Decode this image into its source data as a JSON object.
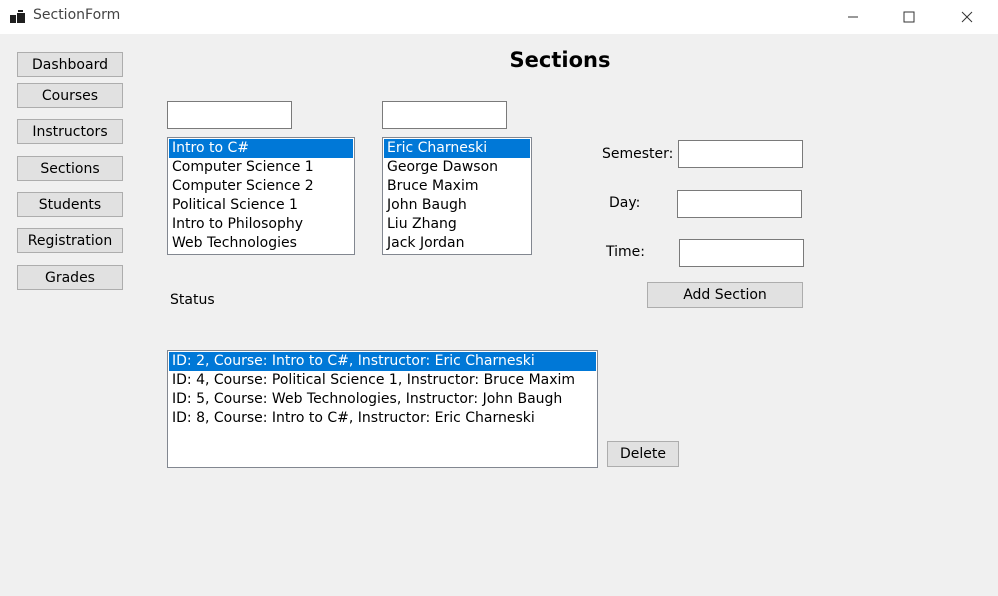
{
  "window": {
    "title": "SectionForm"
  },
  "nav": {
    "dashboard": "Dashboard",
    "courses": "Courses",
    "instructors": "Instructors",
    "sections": "Sections",
    "students": "Students",
    "registration": "Registration",
    "grades": "Grades"
  },
  "page": {
    "title": "Sections"
  },
  "course_filter": {
    "value": ""
  },
  "instructor_filter": {
    "value": ""
  },
  "courses": {
    "selected_index": 0,
    "items": [
      "Intro to C#",
      "Computer Science 1",
      "Computer Science 2",
      "Political Science 1",
      "Intro to Philosophy",
      "Web Technologies"
    ]
  },
  "instructors": {
    "selected_index": 0,
    "items": [
      "Eric Charneski",
      "George Dawson",
      "Bruce Maxim",
      "John Baugh",
      "Liu Zhang",
      "Jack Jordan"
    ]
  },
  "form": {
    "semester_label": "Semester:",
    "semester_value": "",
    "day_label": "Day:",
    "day_value": "",
    "time_label": "Time:",
    "time_value": "",
    "add_button": "Add Section"
  },
  "status": {
    "label": "Status"
  },
  "sections": {
    "selected_index": 0,
    "items": [
      "ID: 2, Course: Intro to C#, Instructor: Eric Charneski",
      "ID: 4, Course: Political Science 1, Instructor: Bruce Maxim",
      "ID: 5, Course: Web Technologies, Instructor: John Baugh",
      "ID: 8, Course: Intro to C#, Instructor: Eric Charneski"
    ]
  },
  "delete_button": "Delete",
  "colors": {
    "selection": "#0078d7",
    "background": "#f0f0f0",
    "button": "#e1e1e1"
  }
}
